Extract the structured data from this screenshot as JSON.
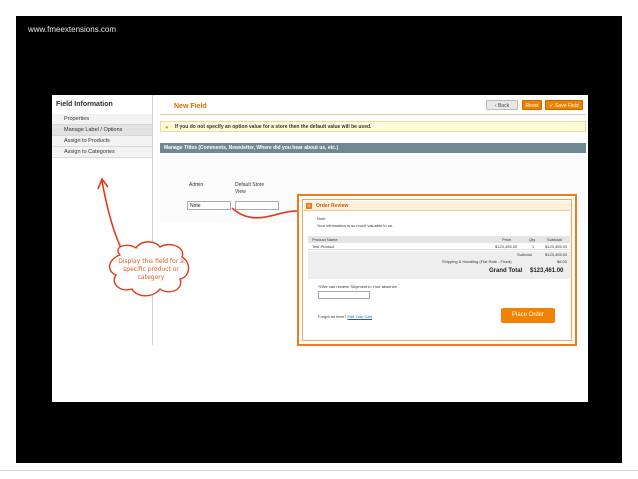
{
  "site_url": "www.fmeextensions.com",
  "sidebar": {
    "title": "Field Information",
    "items": [
      {
        "label": "Properties"
      },
      {
        "label": "Manage Label / Options"
      },
      {
        "label": "Assign to Products"
      },
      {
        "label": "Assign to Categories"
      }
    ]
  },
  "header": {
    "title": "New Field",
    "back_label": "Back",
    "reset_label": "Reset",
    "save_label": "Save Field"
  },
  "notice": "If you do not specify an option value for a store then the default value will be used.",
  "manage_titles": {
    "bar": "Manage Titles (Comments, Newsletter, Where did you hear about us, etc.)",
    "admin_label": "Admin",
    "default_store_label": "Default Store View",
    "admin_value": "Note",
    "default_store_value": ""
  },
  "callout": {
    "text": "Display this field for a specific product or category"
  },
  "order_review": {
    "number": "5",
    "title": "Order Review",
    "note_label": "Note",
    "note_text": "Your information is so much valuable to us.",
    "columns": [
      "Product Name",
      "Price",
      "Qty",
      "Subtotal"
    ],
    "rows": [
      {
        "name": "Test Product",
        "price": "$123,455.00",
        "qty": "1",
        "subtotal": "$123,455.00"
      }
    ],
    "subtotal_label": "Subtotal",
    "subtotal_value": "$123,455.00",
    "shipping_label": "Shipping & Handling (Flat Rate - Fixed)",
    "shipping_value": "$6.00",
    "grand_total_label": "Grand Total",
    "grand_total_value": "$123,461.00",
    "shipment_question": "*I/We can recieve Shipment in Your absence",
    "forgot_text": "Forgot an Item?",
    "edit_cart_link": "Edit Your Cart",
    "place_order_label": "Place Order"
  },
  "colors": {
    "accent": "#f18200",
    "bar": "#6f8992",
    "callout_text": "#e05a1a"
  }
}
